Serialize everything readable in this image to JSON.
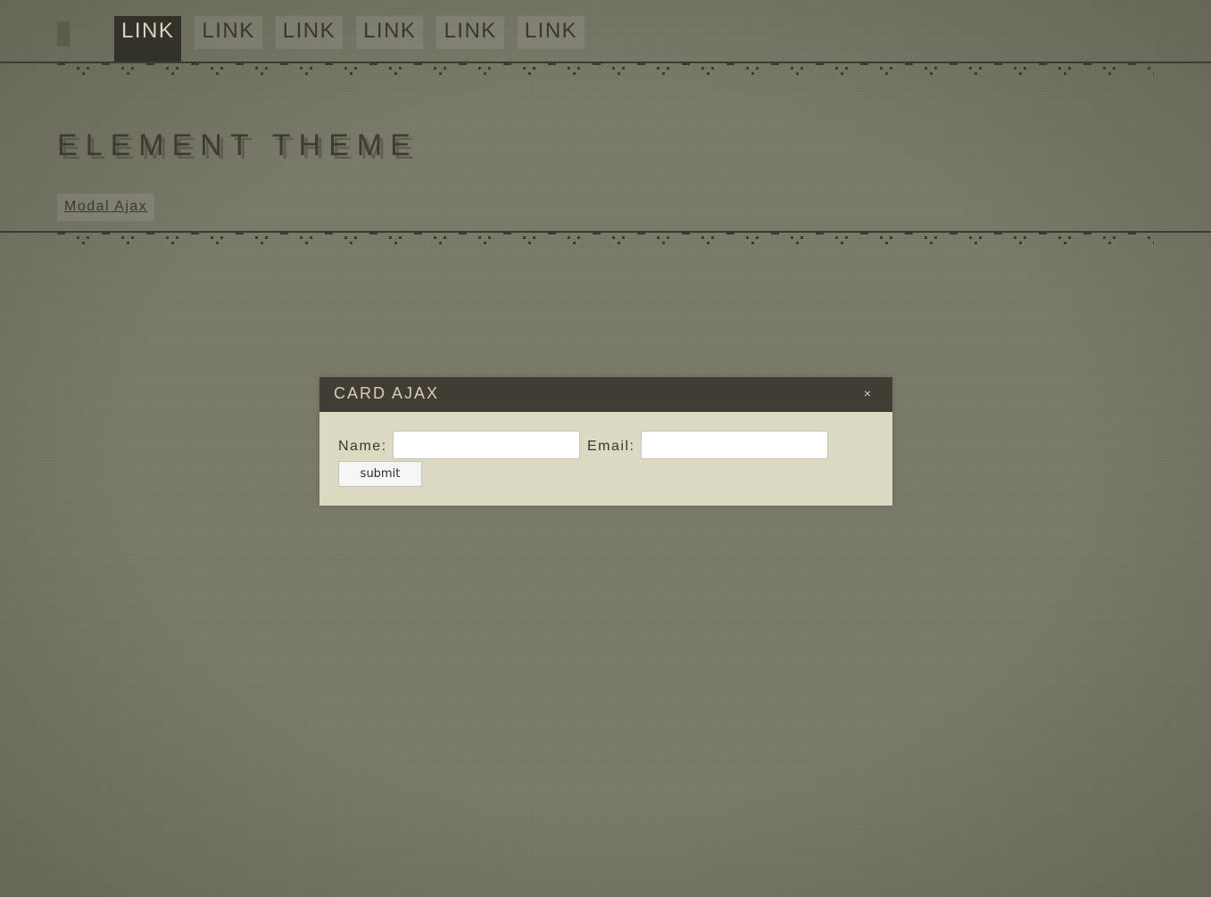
{
  "nav": {
    "links": [
      {
        "label": "LINK",
        "active": true
      },
      {
        "label": "LINK",
        "active": false
      },
      {
        "label": "LINK",
        "active": false
      },
      {
        "label": "LINK",
        "active": false
      },
      {
        "label": "LINK",
        "active": false
      },
      {
        "label": "LINK",
        "active": false
      }
    ]
  },
  "page": {
    "title": "ELEMENT THEME",
    "modal_trigger": "Modal Ajax"
  },
  "modal": {
    "title": "CARD AJAX",
    "close_glyph": "×",
    "form": {
      "name_label": "Name:",
      "name_value": "",
      "email_label": "Email:",
      "email_value": "",
      "submit_label": "submit"
    }
  },
  "colors": {
    "background": "#7d7b6a",
    "nav_active_bg": "#34312a",
    "modal_header_bg": "#413c34",
    "modal_body_bg": "#dcd9c2",
    "rule": "#3d3b31"
  },
  "icons": {
    "brand": "logo-mark-icon",
    "close": "close-icon"
  }
}
